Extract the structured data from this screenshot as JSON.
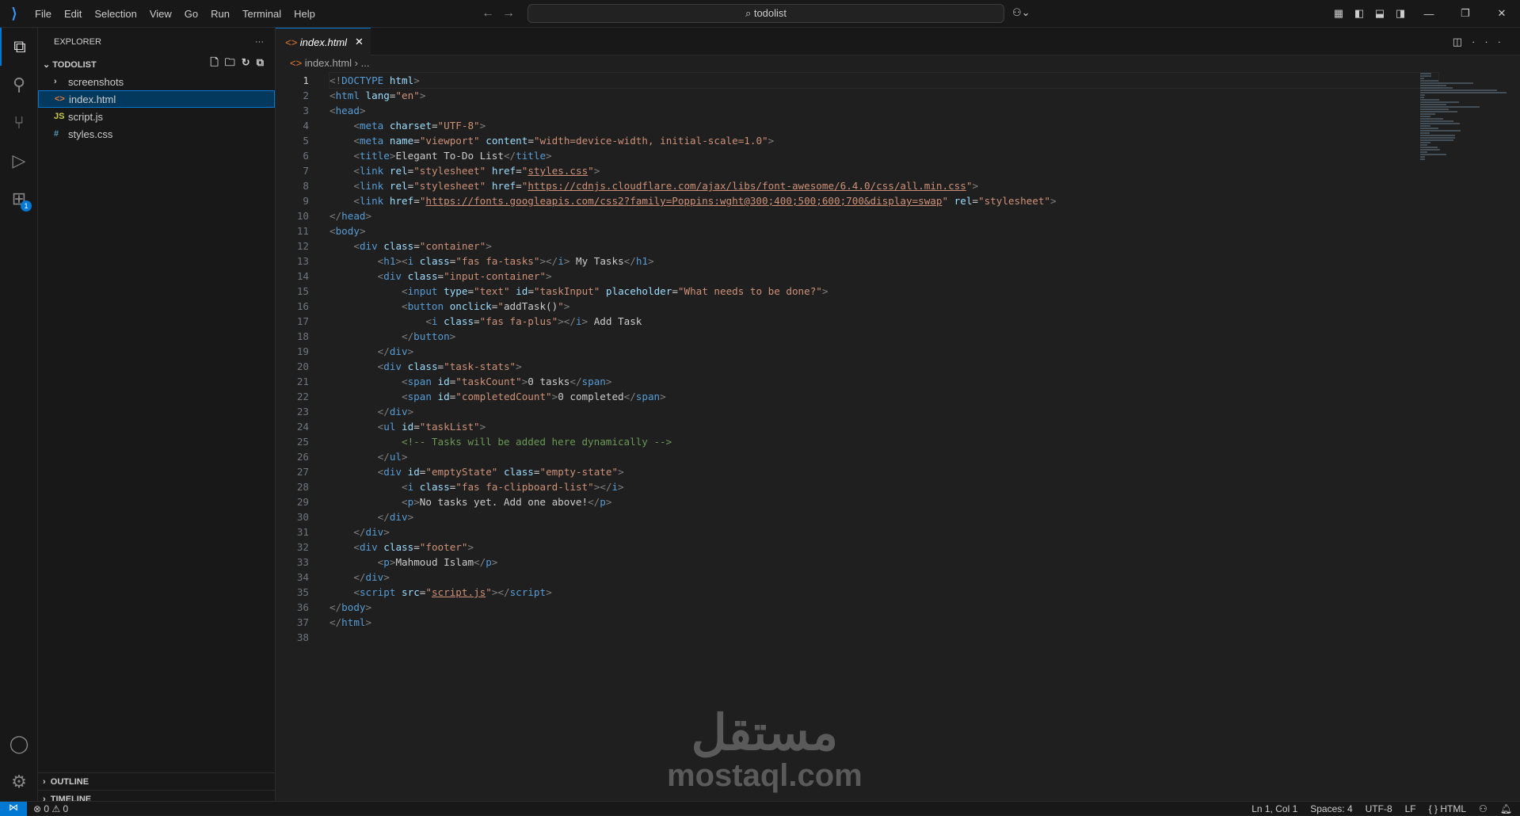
{
  "titlebar": {
    "menu": [
      "File",
      "Edit",
      "Selection",
      "View",
      "Go",
      "Run",
      "Terminal",
      "Help"
    ],
    "search": "todolist"
  },
  "activity": {
    "extensions_badge": "1"
  },
  "explorer": {
    "title": "EXPLORER",
    "more": "···",
    "folder": "TODOLIST",
    "items": [
      {
        "icon": "›",
        "label": "screenshots",
        "type": "folder"
      },
      {
        "icon": "<>",
        "label": "index.html",
        "type": "html",
        "selected": true
      },
      {
        "icon": "JS",
        "label": "script.js",
        "type": "js"
      },
      {
        "icon": "#",
        "label": "styles.css",
        "type": "css"
      }
    ],
    "outline": "OUTLINE",
    "timeline": "TIMELINE"
  },
  "tab": {
    "label": "index.html",
    "close": "✕"
  },
  "breadcrumb": {
    "file": "index.html",
    "rest": "› ..."
  },
  "code": [
    [
      [
        "b",
        "<!"
      ],
      [
        "t",
        "DOCTYPE"
      ],
      [
        "x",
        " "
      ],
      [
        "a",
        "html"
      ],
      [
        "b",
        ">"
      ]
    ],
    [
      [
        "b",
        "<"
      ],
      [
        "t",
        "html"
      ],
      [
        "x",
        " "
      ],
      [
        "a",
        "lang"
      ],
      [
        "x",
        "="
      ],
      [
        "s",
        "\"en\""
      ],
      [
        "b",
        ">"
      ]
    ],
    [
      [
        "b",
        "<"
      ],
      [
        "t",
        "head"
      ],
      [
        "b",
        ">"
      ]
    ],
    [
      [
        "x",
        "    "
      ],
      [
        "b",
        "<"
      ],
      [
        "t",
        "meta"
      ],
      [
        "x",
        " "
      ],
      [
        "a",
        "charset"
      ],
      [
        "x",
        "="
      ],
      [
        "s",
        "\"UTF-8\""
      ],
      [
        "b",
        ">"
      ]
    ],
    [
      [
        "x",
        "    "
      ],
      [
        "b",
        "<"
      ],
      [
        "t",
        "meta"
      ],
      [
        "x",
        " "
      ],
      [
        "a",
        "name"
      ],
      [
        "x",
        "="
      ],
      [
        "s",
        "\"viewport\""
      ],
      [
        "x",
        " "
      ],
      [
        "a",
        "content"
      ],
      [
        "x",
        "="
      ],
      [
        "s",
        "\"width=device-width, initial-scale=1.0\""
      ],
      [
        "b",
        ">"
      ]
    ],
    [
      [
        "x",
        "    "
      ],
      [
        "b",
        "<"
      ],
      [
        "t",
        "title"
      ],
      [
        "b",
        ">"
      ],
      [
        "x",
        "Elegant To-Do List"
      ],
      [
        "b",
        "</"
      ],
      [
        "t",
        "title"
      ],
      [
        "b",
        ">"
      ]
    ],
    [
      [
        "x",
        "    "
      ],
      [
        "b",
        "<"
      ],
      [
        "t",
        "link"
      ],
      [
        "x",
        " "
      ],
      [
        "a",
        "rel"
      ],
      [
        "x",
        "="
      ],
      [
        "s",
        "\"stylesheet\""
      ],
      [
        "x",
        " "
      ],
      [
        "a",
        "href"
      ],
      [
        "x",
        "="
      ],
      [
        "s",
        "\""
      ],
      [
        "u",
        "styles.css"
      ],
      [
        "s",
        "\""
      ],
      [
        "b",
        ">"
      ]
    ],
    [
      [
        "x",
        "    "
      ],
      [
        "b",
        "<"
      ],
      [
        "t",
        "link"
      ],
      [
        "x",
        " "
      ],
      [
        "a",
        "rel"
      ],
      [
        "x",
        "="
      ],
      [
        "s",
        "\"stylesheet\""
      ],
      [
        "x",
        " "
      ],
      [
        "a",
        "href"
      ],
      [
        "x",
        "="
      ],
      [
        "s",
        "\""
      ],
      [
        "u",
        "https://cdnjs.cloudflare.com/ajax/libs/font-awesome/6.4.0/css/all.min.css"
      ],
      [
        "s",
        "\""
      ],
      [
        "b",
        ">"
      ]
    ],
    [
      [
        "x",
        "    "
      ],
      [
        "b",
        "<"
      ],
      [
        "t",
        "link"
      ],
      [
        "x",
        " "
      ],
      [
        "a",
        "href"
      ],
      [
        "x",
        "="
      ],
      [
        "s",
        "\""
      ],
      [
        "u",
        "https://fonts.googleapis.com/css2?family=Poppins:wght@300;400;500;600;700&display=swap"
      ],
      [
        "s",
        "\""
      ],
      [
        "x",
        " "
      ],
      [
        "a",
        "rel"
      ],
      [
        "x",
        "="
      ],
      [
        "s",
        "\"stylesheet\""
      ],
      [
        "b",
        ">"
      ]
    ],
    [
      [
        "b",
        "</"
      ],
      [
        "t",
        "head"
      ],
      [
        "b",
        ">"
      ]
    ],
    [
      [
        "b",
        "<"
      ],
      [
        "t",
        "body"
      ],
      [
        "b",
        ">"
      ]
    ],
    [
      [
        "x",
        "    "
      ],
      [
        "b",
        "<"
      ],
      [
        "t",
        "div"
      ],
      [
        "x",
        " "
      ],
      [
        "a",
        "class"
      ],
      [
        "x",
        "="
      ],
      [
        "s",
        "\"container\""
      ],
      [
        "b",
        ">"
      ]
    ],
    [
      [
        "x",
        "        "
      ],
      [
        "b",
        "<"
      ],
      [
        "t",
        "h1"
      ],
      [
        "b",
        "><"
      ],
      [
        "t",
        "i"
      ],
      [
        "x",
        " "
      ],
      [
        "a",
        "class"
      ],
      [
        "x",
        "="
      ],
      [
        "s",
        "\"fas fa-tasks\""
      ],
      [
        "b",
        "></"
      ],
      [
        "t",
        "i"
      ],
      [
        "b",
        ">"
      ],
      [
        "x",
        " My Tasks"
      ],
      [
        "b",
        "</"
      ],
      [
        "t",
        "h1"
      ],
      [
        "b",
        ">"
      ]
    ],
    [
      [
        "x",
        "        "
      ],
      [
        "b",
        "<"
      ],
      [
        "t",
        "div"
      ],
      [
        "x",
        " "
      ],
      [
        "a",
        "class"
      ],
      [
        "x",
        "="
      ],
      [
        "s",
        "\"input-container\""
      ],
      [
        "b",
        ">"
      ]
    ],
    [
      [
        "x",
        "            "
      ],
      [
        "b",
        "<"
      ],
      [
        "t",
        "input"
      ],
      [
        "x",
        " "
      ],
      [
        "a",
        "type"
      ],
      [
        "x",
        "="
      ],
      [
        "s",
        "\"text\""
      ],
      [
        "x",
        " "
      ],
      [
        "a",
        "id"
      ],
      [
        "x",
        "="
      ],
      [
        "s",
        "\"taskInput\""
      ],
      [
        "x",
        " "
      ],
      [
        "a",
        "placeholder"
      ],
      [
        "x",
        "="
      ],
      [
        "s",
        "\"What needs to be done?\""
      ],
      [
        "b",
        ">"
      ]
    ],
    [
      [
        "x",
        "            "
      ],
      [
        "b",
        "<"
      ],
      [
        "t",
        "button"
      ],
      [
        "x",
        " "
      ],
      [
        "a",
        "onclick"
      ],
      [
        "x",
        "="
      ],
      [
        "s",
        "\""
      ],
      [
        "x",
        "addTask()"
      ],
      [
        "s",
        "\""
      ],
      [
        "b",
        ">"
      ]
    ],
    [
      [
        "x",
        "                "
      ],
      [
        "b",
        "<"
      ],
      [
        "t",
        "i"
      ],
      [
        "x",
        " "
      ],
      [
        "a",
        "class"
      ],
      [
        "x",
        "="
      ],
      [
        "s",
        "\"fas fa-plus\""
      ],
      [
        "b",
        "></"
      ],
      [
        "t",
        "i"
      ],
      [
        "b",
        ">"
      ],
      [
        "x",
        " Add Task"
      ]
    ],
    [
      [
        "x",
        "            "
      ],
      [
        "b",
        "</"
      ],
      [
        "t",
        "button"
      ],
      [
        "b",
        ">"
      ]
    ],
    [
      [
        "x",
        "        "
      ],
      [
        "b",
        "</"
      ],
      [
        "t",
        "div"
      ],
      [
        "b",
        ">"
      ]
    ],
    [
      [
        "x",
        "        "
      ],
      [
        "b",
        "<"
      ],
      [
        "t",
        "div"
      ],
      [
        "x",
        " "
      ],
      [
        "a",
        "class"
      ],
      [
        "x",
        "="
      ],
      [
        "s",
        "\"task-stats\""
      ],
      [
        "b",
        ">"
      ]
    ],
    [
      [
        "x",
        "            "
      ],
      [
        "b",
        "<"
      ],
      [
        "t",
        "span"
      ],
      [
        "x",
        " "
      ],
      [
        "a",
        "id"
      ],
      [
        "x",
        "="
      ],
      [
        "s",
        "\"taskCount\""
      ],
      [
        "b",
        ">"
      ],
      [
        "x",
        "0 tasks"
      ],
      [
        "b",
        "</"
      ],
      [
        "t",
        "span"
      ],
      [
        "b",
        ">"
      ]
    ],
    [
      [
        "x",
        "            "
      ],
      [
        "b",
        "<"
      ],
      [
        "t",
        "span"
      ],
      [
        "x",
        " "
      ],
      [
        "a",
        "id"
      ],
      [
        "x",
        "="
      ],
      [
        "s",
        "\"completedCount\""
      ],
      [
        "b",
        ">"
      ],
      [
        "x",
        "0 completed"
      ],
      [
        "b",
        "</"
      ],
      [
        "t",
        "span"
      ],
      [
        "b",
        ">"
      ]
    ],
    [
      [
        "x",
        "        "
      ],
      [
        "b",
        "</"
      ],
      [
        "t",
        "div"
      ],
      [
        "b",
        ">"
      ]
    ],
    [
      [
        "x",
        "        "
      ],
      [
        "b",
        "<"
      ],
      [
        "t",
        "ul"
      ],
      [
        "x",
        " "
      ],
      [
        "a",
        "id"
      ],
      [
        "x",
        "="
      ],
      [
        "s",
        "\"taskList\""
      ],
      [
        "b",
        ">"
      ]
    ],
    [
      [
        "x",
        "            "
      ],
      [
        "c",
        "<!-- Tasks will be added here dynamically -->"
      ]
    ],
    [
      [
        "x",
        "        "
      ],
      [
        "b",
        "</"
      ],
      [
        "t",
        "ul"
      ],
      [
        "b",
        ">"
      ]
    ],
    [
      [
        "x",
        "        "
      ],
      [
        "b",
        "<"
      ],
      [
        "t",
        "div"
      ],
      [
        "x",
        " "
      ],
      [
        "a",
        "id"
      ],
      [
        "x",
        "="
      ],
      [
        "s",
        "\"emptyState\""
      ],
      [
        "x",
        " "
      ],
      [
        "a",
        "class"
      ],
      [
        "x",
        "="
      ],
      [
        "s",
        "\"empty-state\""
      ],
      [
        "b",
        ">"
      ]
    ],
    [
      [
        "x",
        "            "
      ],
      [
        "b",
        "<"
      ],
      [
        "t",
        "i"
      ],
      [
        "x",
        " "
      ],
      [
        "a",
        "class"
      ],
      [
        "x",
        "="
      ],
      [
        "s",
        "\"fas fa-clipboard-list\""
      ],
      [
        "b",
        "></"
      ],
      [
        "t",
        "i"
      ],
      [
        "b",
        ">"
      ]
    ],
    [
      [
        "x",
        "            "
      ],
      [
        "b",
        "<"
      ],
      [
        "t",
        "p"
      ],
      [
        "b",
        ">"
      ],
      [
        "x",
        "No tasks yet. Add one above!"
      ],
      [
        "b",
        "</"
      ],
      [
        "t",
        "p"
      ],
      [
        "b",
        ">"
      ]
    ],
    [
      [
        "x",
        "        "
      ],
      [
        "b",
        "</"
      ],
      [
        "t",
        "div"
      ],
      [
        "b",
        ">"
      ]
    ],
    [
      [
        "x",
        "    "
      ],
      [
        "b",
        "</"
      ],
      [
        "t",
        "div"
      ],
      [
        "b",
        ">"
      ]
    ],
    [
      [
        "x",
        "    "
      ],
      [
        "b",
        "<"
      ],
      [
        "t",
        "div"
      ],
      [
        "x",
        " "
      ],
      [
        "a",
        "class"
      ],
      [
        "x",
        "="
      ],
      [
        "s",
        "\"footer\""
      ],
      [
        "b",
        ">"
      ]
    ],
    [
      [
        "x",
        "        "
      ],
      [
        "b",
        "<"
      ],
      [
        "t",
        "p"
      ],
      [
        "b",
        ">"
      ],
      [
        "x",
        "Mahmoud Islam"
      ],
      [
        "b",
        "</"
      ],
      [
        "t",
        "p"
      ],
      [
        "b",
        ">"
      ]
    ],
    [
      [
        "x",
        "    "
      ],
      [
        "b",
        "</"
      ],
      [
        "t",
        "div"
      ],
      [
        "b",
        ">"
      ]
    ],
    [
      [
        "x",
        "    "
      ],
      [
        "b",
        "<"
      ],
      [
        "t",
        "script"
      ],
      [
        "x",
        " "
      ],
      [
        "a",
        "src"
      ],
      [
        "x",
        "="
      ],
      [
        "s",
        "\""
      ],
      [
        "u",
        "script.js"
      ],
      [
        "s",
        "\""
      ],
      [
        "b",
        "></"
      ],
      [
        "t",
        "script"
      ],
      [
        "b",
        ">"
      ]
    ],
    [
      [
        "b",
        "</"
      ],
      [
        "t",
        "body"
      ],
      [
        "b",
        ">"
      ]
    ],
    [
      [
        "b",
        "</"
      ],
      [
        "t",
        "html"
      ],
      [
        "b",
        ">"
      ]
    ],
    []
  ],
  "watermark": {
    "arabic": "مستقل",
    "latin": "mostaql.com"
  },
  "status": {
    "errors": "0",
    "warnings": "0",
    "position": "Ln 1, Col 1",
    "spaces": "Spaces: 4",
    "encoding": "UTF-8",
    "eol": "LF",
    "language": "HTML"
  }
}
